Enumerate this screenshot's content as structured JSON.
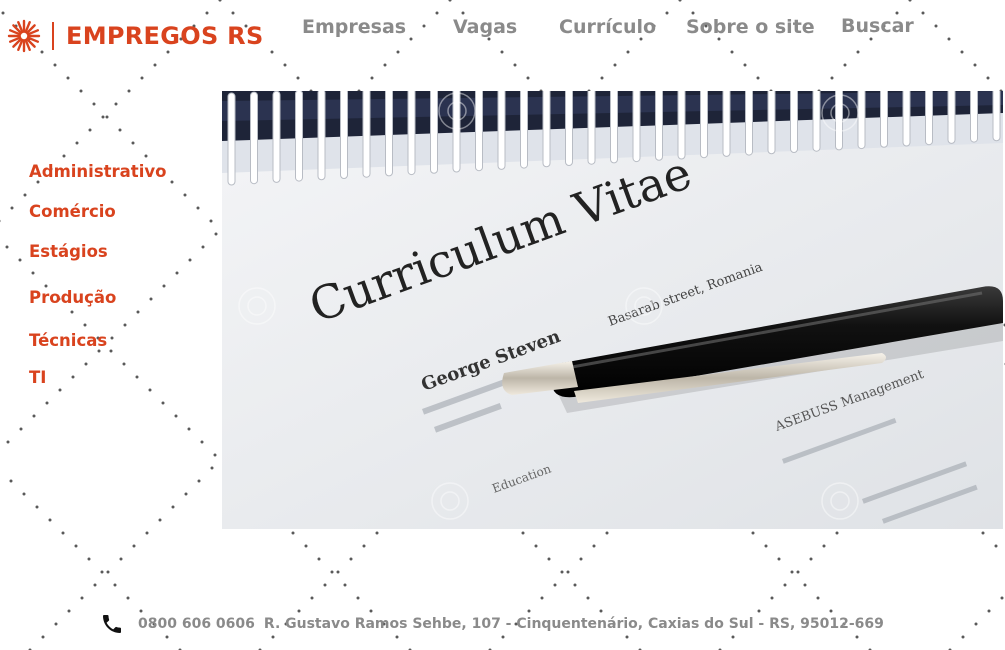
{
  "brand": {
    "name": "EMPREGOS RS",
    "logo_icon": "starburst-icon",
    "accent_color": "#d9431e"
  },
  "nav": {
    "items": [
      {
        "label": "Empresas"
      },
      {
        "label": "Vagas"
      },
      {
        "label": "Currículo"
      },
      {
        "label": "Sobre o site"
      },
      {
        "label": "Buscar"
      }
    ],
    "color": "#8a8a8a"
  },
  "sidebar": {
    "items": [
      {
        "label": "Administrativo"
      },
      {
        "label": "Comércio"
      },
      {
        "label": "Estágios"
      },
      {
        "label": "Produção"
      },
      {
        "label": "Técnicas"
      },
      {
        "label": "TI"
      }
    ]
  },
  "hero": {
    "image_subject": "curriculum-vitae-with-pen-photo",
    "heading": "Curriculum Vitae",
    "name": "George Steven",
    "address": "Basarab street, Romania",
    "company": "ASEBUSS Management",
    "section": "Education"
  },
  "footer": {
    "phone_icon": "phone-icon",
    "phone": "0800 606 0606",
    "address": "R. Gustavo Ramos Sehbe, 107 - Cinquentenário, Caxias do Sul - RS, 95012-669"
  }
}
